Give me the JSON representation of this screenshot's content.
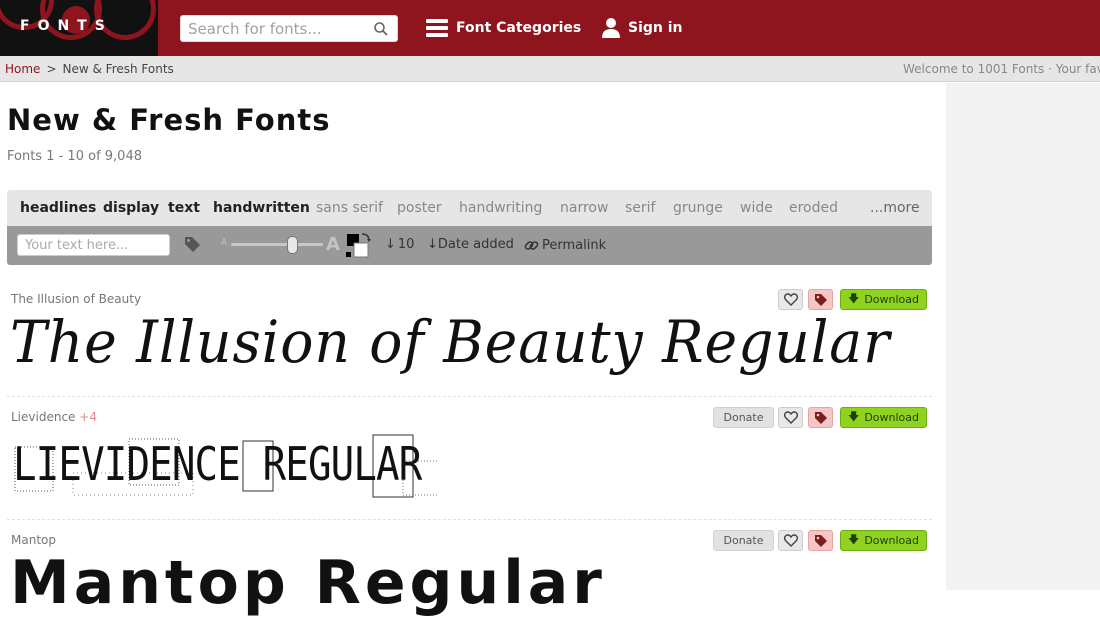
{
  "header": {
    "logo_text": "FONTS",
    "search_placeholder": "Search for fonts...",
    "nav": [
      {
        "label": "Font Categories",
        "icon": "hamburger-icon"
      },
      {
        "label": "Sign in",
        "icon": "user-icon"
      }
    ]
  },
  "breadcrumb": {
    "home": "Home",
    "separator": ">",
    "current": "New & Fresh Fonts",
    "welcome": "Welcome to 1001 Fonts · Your fav"
  },
  "main": {
    "title": "New & Fresh Fonts",
    "count": "Fonts 1 - 10 of 9,048"
  },
  "categories": [
    {
      "label": "headlines",
      "style": "dark"
    },
    {
      "label": "display",
      "style": "dark"
    },
    {
      "label": "text",
      "style": "dark"
    },
    {
      "label": "handwritten",
      "style": "dark"
    },
    {
      "label": "sans serif",
      "style": "light"
    },
    {
      "label": "poster",
      "style": "light"
    },
    {
      "label": "handwriting",
      "style": "light"
    },
    {
      "label": "narrow",
      "style": "light"
    },
    {
      "label": "serif",
      "style": "light"
    },
    {
      "label": "grunge",
      "style": "light"
    },
    {
      "label": "wide",
      "style": "light"
    },
    {
      "label": "eroded",
      "style": "light"
    },
    {
      "label": "...more",
      "style": "more"
    }
  ],
  "toolbar": {
    "text_placeholder": "Your text here...",
    "size_small": "A",
    "size_big": "A",
    "per_page": "10",
    "sort": "Date added",
    "permalink": "Permalink"
  },
  "fonts": [
    {
      "name": "The Illusion of Beauty",
      "extra": "",
      "preview": "The Illusion of Beauty Regular",
      "donate": false
    },
    {
      "name": "Lievidence",
      "extra": "+4",
      "preview": "LIEVIDENCE REGULAR",
      "donate": true
    },
    {
      "name": "Mantop",
      "extra": "",
      "preview": "Mantop Regular",
      "donate": true
    }
  ],
  "buttons": {
    "donate": "Donate",
    "download": "Download"
  },
  "colors": {
    "header_bg": "#8e141d",
    "download_green": "#8fd21f",
    "tag_pink": "#f4c6c6"
  }
}
